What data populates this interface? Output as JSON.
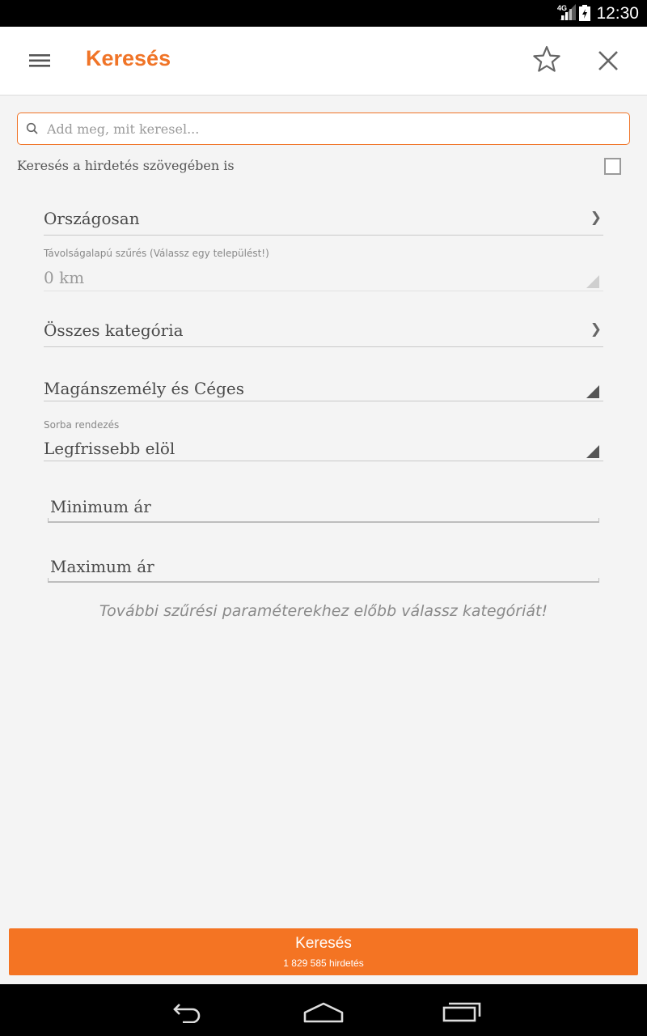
{
  "status_bar": {
    "network": "4G",
    "time": "12:30"
  },
  "app_bar": {
    "title": "Keresés",
    "accent_color": "#f07427",
    "icons": [
      "menu-icon",
      "star-icon",
      "close-icon"
    ]
  },
  "search": {
    "placeholder": "Add meg, mit keresel...",
    "value": ""
  },
  "fulltext_option": {
    "label": "Keresés a hirdetés szövegében is",
    "checked": false
  },
  "filters": {
    "location": "Országosan",
    "distance_caption": "Távolságalapú szűrés (Válassz egy települést!)",
    "distance_value": "0 km",
    "category": "Összes kategória",
    "seller_type": "Magánszemély és Céges",
    "sort_caption": "Sorba rendezés",
    "sort_value": "Legfrissebb elöl",
    "min_price_placeholder": "Minimum ár",
    "max_price_placeholder": "Maximum ár",
    "hint": "További szűrési paraméterekhez előbb válassz kategóriát!"
  },
  "action": {
    "button_label": "Keresés",
    "result_count": "1 829 585 hirdetés",
    "button_color": "#f47423"
  },
  "nav_bar": {
    "icons": [
      "back-icon",
      "home-icon",
      "recents-icon"
    ]
  }
}
